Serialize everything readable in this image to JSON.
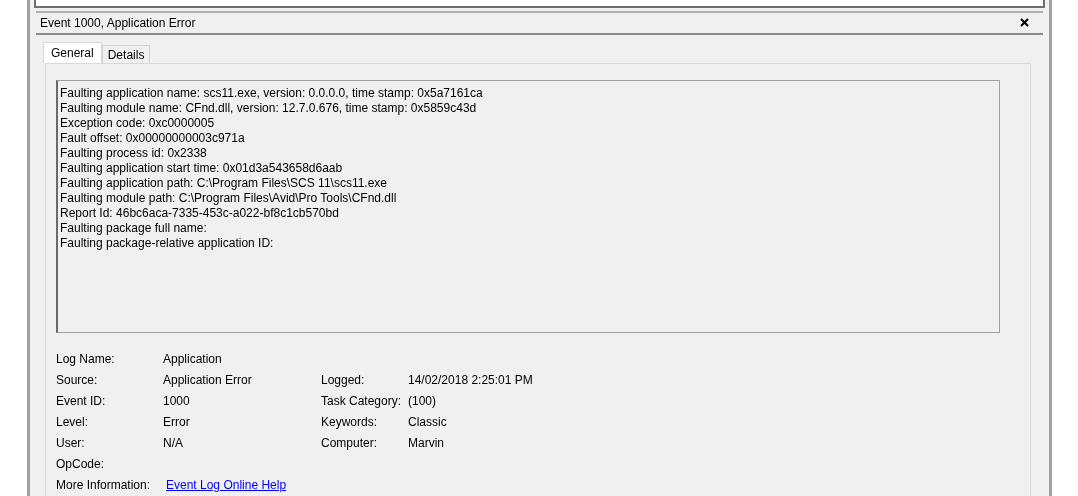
{
  "window": {
    "title": "Event 1000, Application Error"
  },
  "tabs": [
    {
      "label": "General",
      "selected": true
    },
    {
      "label": "Details",
      "selected": false
    }
  ],
  "description": {
    "lines": [
      "Faulting application name: scs11.exe, version: 0.0.0.0, time stamp: 0x5a7161ca",
      "Faulting module name: CFnd.dll, version: 12.7.0.676, time stamp: 0x5859c43d",
      "Exception code: 0xc0000005",
      "Fault offset: 0x00000000003c971a",
      "Faulting process id: 0x2338",
      "Faulting application start time: 0x01d3a543658d6aab",
      "Faulting application path: C:\\Program Files\\SCS 11\\scs11.exe",
      "Faulting module path: C:\\Program Files\\Avid\\Pro Tools\\CFnd.dll",
      "Report Id: 46bc6aca-7335-453c-a022-bf8c1cb570bd",
      "Faulting package full name:",
      "Faulting package-relative application ID:"
    ]
  },
  "properties": [
    {
      "label": "Log Name:",
      "value": "Application"
    },
    {
      "label": "Source:",
      "value": "Application Error",
      "label_2": "Logged:",
      "value_2": "14/02/2018 2:25:01 PM"
    },
    {
      "label": "Event ID:",
      "value": "1000",
      "label_2": "Task Category:",
      "value_2": "(100)"
    },
    {
      "label": "Level:",
      "value": "Error",
      "label_2": "Keywords:",
      "value_2": "Classic"
    },
    {
      "label": "User:",
      "value": "N/A",
      "label_2": "Computer:",
      "value_2": "Marvin"
    },
    {
      "label": "OpCode:"
    }
  ],
  "more_information": {
    "label": "More Information:",
    "link": "Event Log Online Help"
  }
}
